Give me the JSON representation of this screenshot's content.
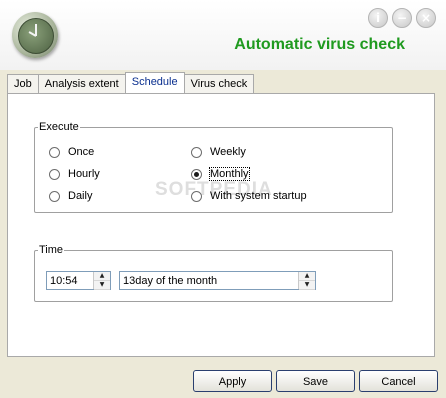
{
  "header": {
    "title": "Automatic virus check",
    "icons": [
      {
        "name": "info-icon",
        "glyph": "i"
      },
      {
        "name": "minimize-icon",
        "glyph": "−"
      },
      {
        "name": "close-icon",
        "glyph": "×"
      }
    ]
  },
  "tabs": [
    {
      "label": "Job"
    },
    {
      "label": "Analysis extent"
    },
    {
      "label": "Schedule"
    },
    {
      "label": "Virus check"
    }
  ],
  "execute": {
    "legend": "Execute",
    "options": [
      "Once",
      "Hourly",
      "Daily",
      "Weekly",
      "Monthly",
      "With system startup"
    ],
    "selected": "Monthly"
  },
  "time": {
    "legend": "Time",
    "time_value": "10:54",
    "day_value": "13day of the month"
  },
  "watermark": "SOFTPEDIA",
  "buttons": {
    "apply": "Apply",
    "save": "Save",
    "cancel": "Cancel"
  },
  "colors": {
    "title": "#1f9a1f",
    "panel_bg": "#ece9d8",
    "active_tab_text": "#0a2f8f"
  }
}
